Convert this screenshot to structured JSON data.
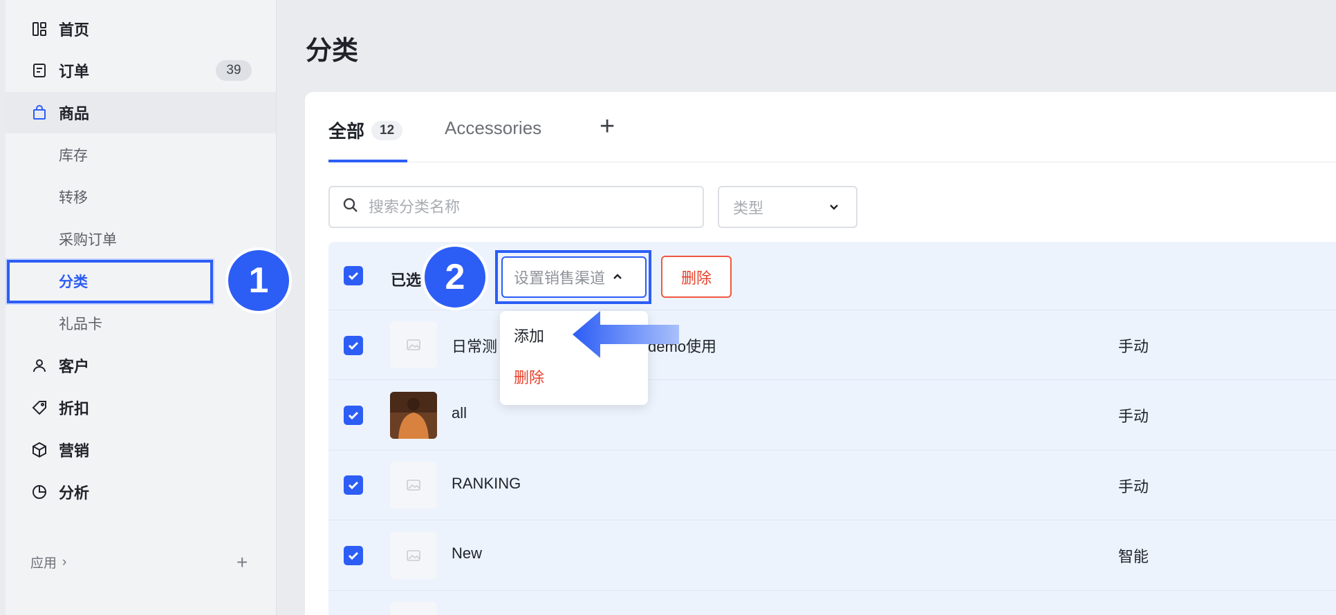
{
  "sidebar": {
    "items": [
      {
        "label": "首页",
        "icon": "dashboard-icon"
      },
      {
        "label": "订单",
        "icon": "order-icon",
        "badge": "39"
      },
      {
        "label": "商品",
        "icon": "bag-icon"
      },
      {
        "label": "库存"
      },
      {
        "label": "转移"
      },
      {
        "label": "采购订单"
      },
      {
        "label": "分类"
      },
      {
        "label": "礼品卡"
      },
      {
        "label": "客户",
        "icon": "user-icon"
      },
      {
        "label": "折扣",
        "icon": "tag-icon"
      },
      {
        "label": "营销",
        "icon": "cube-icon"
      },
      {
        "label": "分析",
        "icon": "pie-chart-icon"
      }
    ],
    "apps_label": "应用",
    "apps_chevron": "›",
    "apps_add": "+"
  },
  "steps": {
    "one": "1",
    "two": "2"
  },
  "page": {
    "title": "分类"
  },
  "tabs": {
    "all_label": "全部",
    "all_count": "12",
    "accessories_label": "Accessories",
    "add_label": "+"
  },
  "filters": {
    "search_placeholder": "搜索分类名称",
    "type_placeholder": "类型"
  },
  "bulk": {
    "selected_label": "已选",
    "channel_button": "设置销售渠道",
    "delete_button": "删除",
    "menu": {
      "add": "添加",
      "delete": "删除"
    }
  },
  "rows": [
    {
      "name_prefix": "日常测",
      "name_suffix": "demo使用",
      "kind": "手动"
    },
    {
      "name": "all",
      "kind": "手动"
    },
    {
      "name": "RANKING",
      "kind": "手动"
    },
    {
      "name": "New",
      "kind": "智能"
    }
  ],
  "colors": {
    "accent": "#2c5df5",
    "danger": "#e8402a"
  }
}
